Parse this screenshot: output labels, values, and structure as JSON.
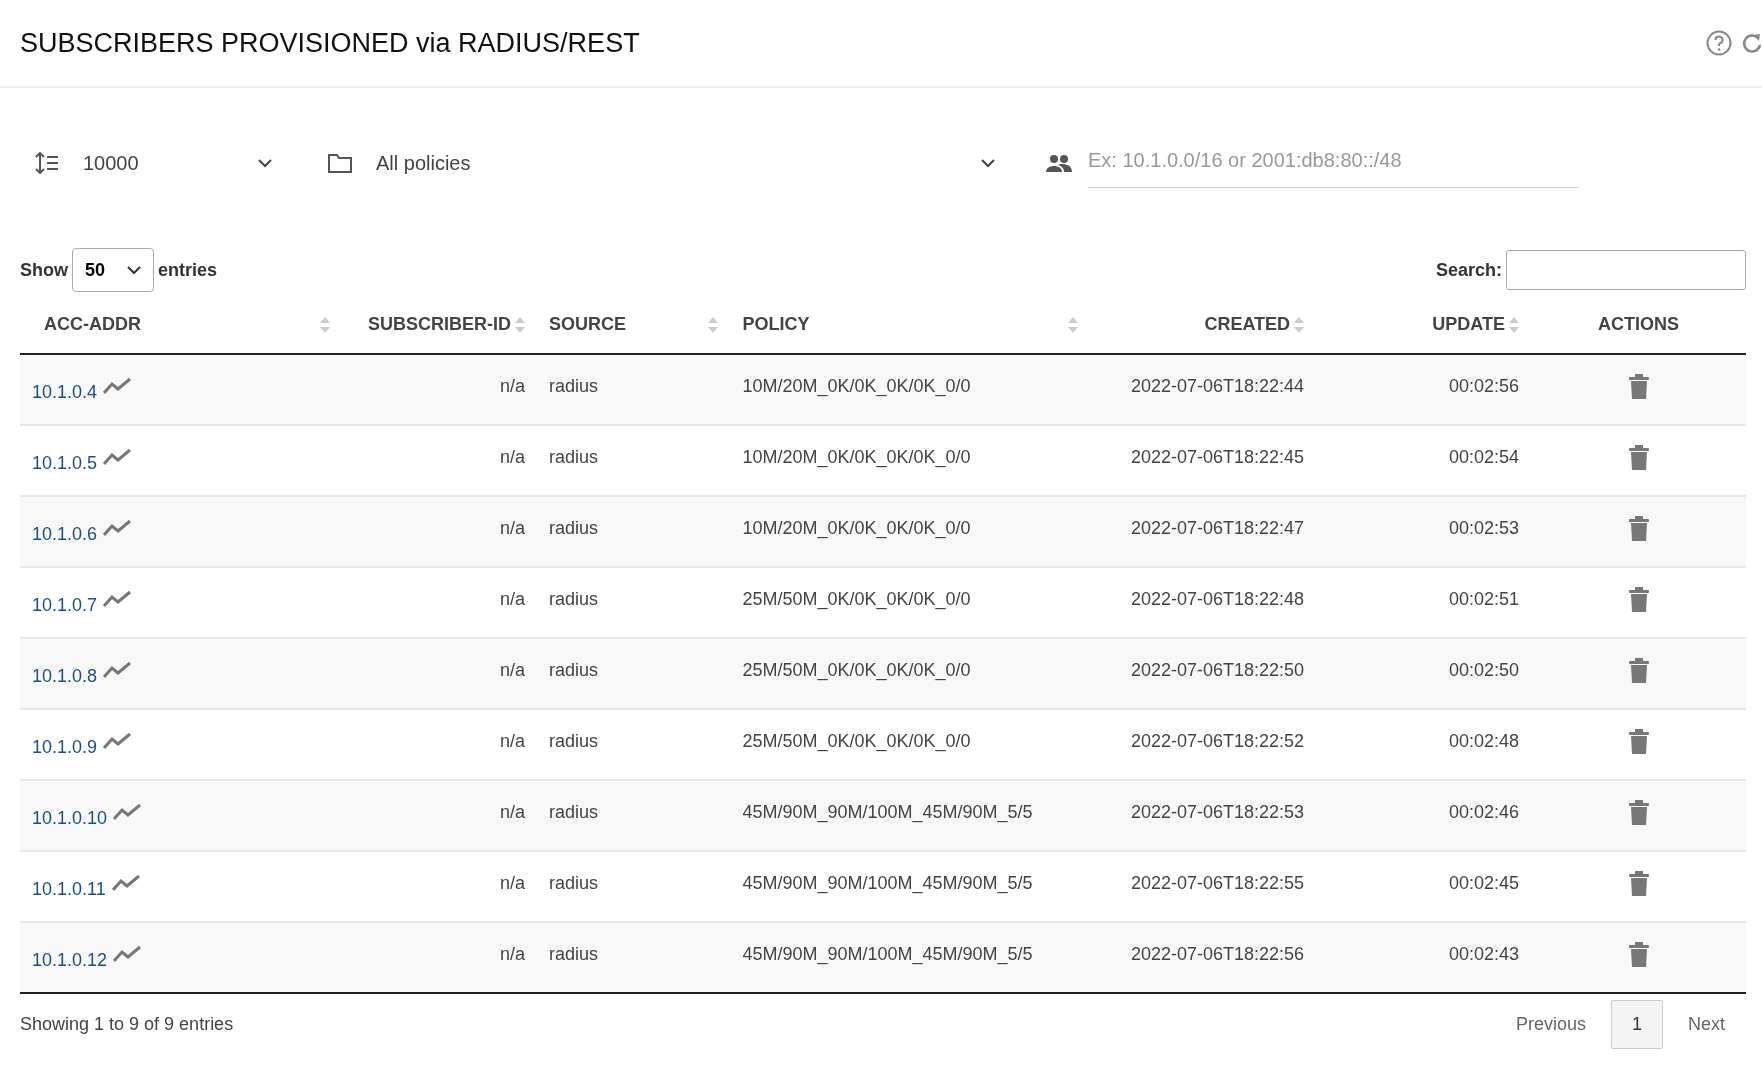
{
  "header": {
    "title": "SUBSCRIBERS PROVISIONED via RADIUS/REST"
  },
  "filters": {
    "limit": "10000",
    "policy": "All policies",
    "range_placeholder": "Ex: 10.1.0.0/16 or 2001:db8:80::/48"
  },
  "length": {
    "label_before": "Show",
    "value": "50",
    "label_after": "entries"
  },
  "search": {
    "label": "Search:"
  },
  "table": {
    "columns": [
      {
        "label": "ACC-ADDR",
        "sortable": true
      },
      {
        "label": "SUBSCRIBER-ID",
        "sortable": true
      },
      {
        "label": "SOURCE",
        "sortable": true
      },
      {
        "label": "POLICY",
        "sortable": true
      },
      {
        "label": "CREATED",
        "sortable": true
      },
      {
        "label": "UPDATE",
        "sortable": true
      },
      {
        "label": "ACTIONS",
        "sortable": false
      }
    ],
    "rows": [
      {
        "addr": "10.1.0.4",
        "subscriber_id": "n/a",
        "source": "radius",
        "policy": "10M/20M_0K/0K_0K/0K_0/0",
        "created": "2022-07-06T18:22:44",
        "update": "00:02:56"
      },
      {
        "addr": "10.1.0.5",
        "subscriber_id": "n/a",
        "source": "radius",
        "policy": "10M/20M_0K/0K_0K/0K_0/0",
        "created": "2022-07-06T18:22:45",
        "update": "00:02:54"
      },
      {
        "addr": "10.1.0.6",
        "subscriber_id": "n/a",
        "source": "radius",
        "policy": "10M/20M_0K/0K_0K/0K_0/0",
        "created": "2022-07-06T18:22:47",
        "update": "00:02:53"
      },
      {
        "addr": "10.1.0.7",
        "subscriber_id": "n/a",
        "source": "radius",
        "policy": "25M/50M_0K/0K_0K/0K_0/0",
        "created": "2022-07-06T18:22:48",
        "update": "00:02:51"
      },
      {
        "addr": "10.1.0.8",
        "subscriber_id": "n/a",
        "source": "radius",
        "policy": "25M/50M_0K/0K_0K/0K_0/0",
        "created": "2022-07-06T18:22:50",
        "update": "00:02:50"
      },
      {
        "addr": "10.1.0.9",
        "subscriber_id": "n/a",
        "source": "radius",
        "policy": "25M/50M_0K/0K_0K/0K_0/0",
        "created": "2022-07-06T18:22:52",
        "update": "00:02:48"
      },
      {
        "addr": "10.1.0.10",
        "subscriber_id": "n/a",
        "source": "radius",
        "policy": "45M/90M_90M/100M_45M/90M_5/5",
        "created": "2022-07-06T18:22:53",
        "update": "00:02:46"
      },
      {
        "addr": "10.1.0.11",
        "subscriber_id": "n/a",
        "source": "radius",
        "policy": "45M/90M_90M/100M_45M/90M_5/5",
        "created": "2022-07-06T18:22:55",
        "update": "00:02:45"
      },
      {
        "addr": "10.1.0.12",
        "subscriber_id": "n/a",
        "source": "radius",
        "policy": "45M/90M_90M/100M_45M/90M_5/5",
        "created": "2022-07-06T18:22:56",
        "update": "00:02:43"
      }
    ]
  },
  "footer": {
    "info": "Showing 1 to 9 of 9 entries",
    "pages": [
      {
        "label": "Previous",
        "selected": false
      },
      {
        "label": "1",
        "selected": true
      },
      {
        "label": "Next",
        "selected": false
      }
    ]
  }
}
